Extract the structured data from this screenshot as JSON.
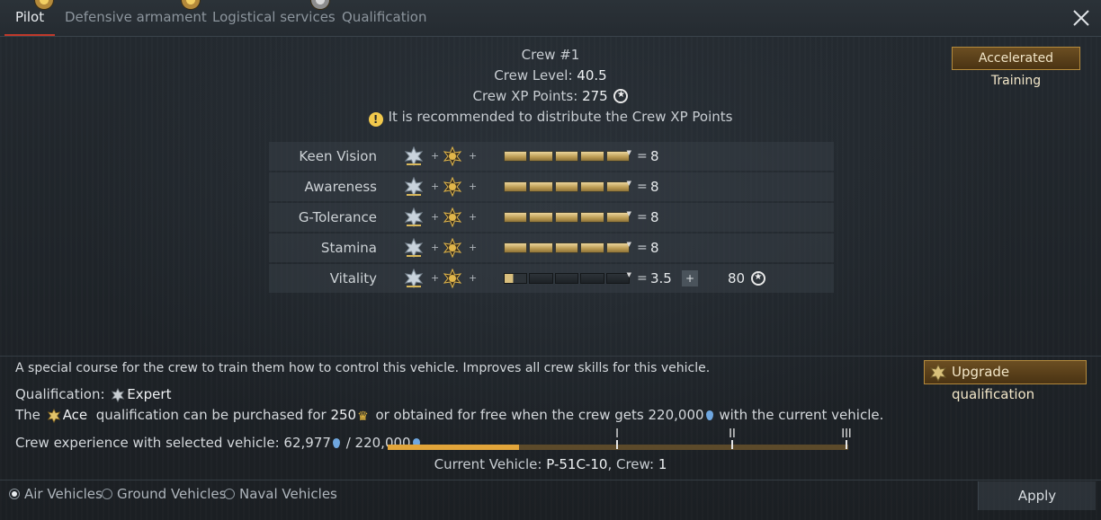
{
  "tabs": [
    {
      "label": "Pilot",
      "active": true,
      "badge": "gold"
    },
    {
      "label": "Defensive armament",
      "active": false,
      "badge": "gold"
    },
    {
      "label": "Logistical services",
      "active": false,
      "badge": "gold"
    },
    {
      "label": "Qualification",
      "active": false,
      "badge": "silver"
    }
  ],
  "crew": {
    "title": "Crew #1",
    "level_label": "Crew Level:",
    "level_value": "40.5",
    "xp_label": "Crew XP Points:",
    "xp_value": "275",
    "recommendation": "It is recommended to distribute the Crew XP Points"
  },
  "accelerated_training_label": "Accelerated Training",
  "skills": [
    {
      "name": "Keen Vision",
      "equals": "=",
      "value": "8",
      "level_fraction": 1.0
    },
    {
      "name": "Awareness",
      "equals": "=",
      "value": "8",
      "level_fraction": 1.0
    },
    {
      "name": "G-Tolerance",
      "equals": "=",
      "value": "8",
      "level_fraction": 1.0
    },
    {
      "name": "Stamina",
      "equals": "=",
      "value": "8",
      "level_fraction": 1.0
    },
    {
      "name": "Vitality",
      "equals": "=",
      "value": "3.5",
      "level_fraction": 0.08,
      "increase_label": "+",
      "cost": "80"
    }
  ],
  "plus_symbol": "+",
  "bottom": {
    "description": "A special course for the crew to train them how to control this vehicle. Improves all crew skills for this vehicle.",
    "qualification_label": "Qualification:",
    "qualification_value": "Expert",
    "upgrade_label": "Upgrade qualification",
    "ace_prefix": "The",
    "ace_name": "Ace",
    "ace_text1": "qualification can be purchased for",
    "ace_price": "250",
    "ace_text2": "or obtained for free when the crew gets",
    "ace_rp": "220,000",
    "ace_text3": "with the current vehicle.",
    "exp_label": "Crew experience with selected vehicle:",
    "exp_current": "62,977",
    "exp_sep": "/",
    "exp_total": "220,000",
    "progress_fraction": 0.286,
    "marks": [
      "I",
      "II",
      "III"
    ],
    "current_vehicle_label": "Current Vehicle:",
    "current_vehicle_value": "P-51C-10",
    "crew_label": "Crew:",
    "crew_value": "1"
  },
  "footer": {
    "radios": [
      {
        "label": "Air Vehicles",
        "selected": true
      },
      {
        "label": "Ground Vehicles",
        "selected": false
      },
      {
        "label": "Naval Vehicles",
        "selected": false
      }
    ],
    "apply_label": "Apply"
  },
  "colors": {
    "accent_gold": "#b48a3c",
    "tab_active_underline": "#c0392b",
    "progress_fill": "#e2a53a"
  }
}
